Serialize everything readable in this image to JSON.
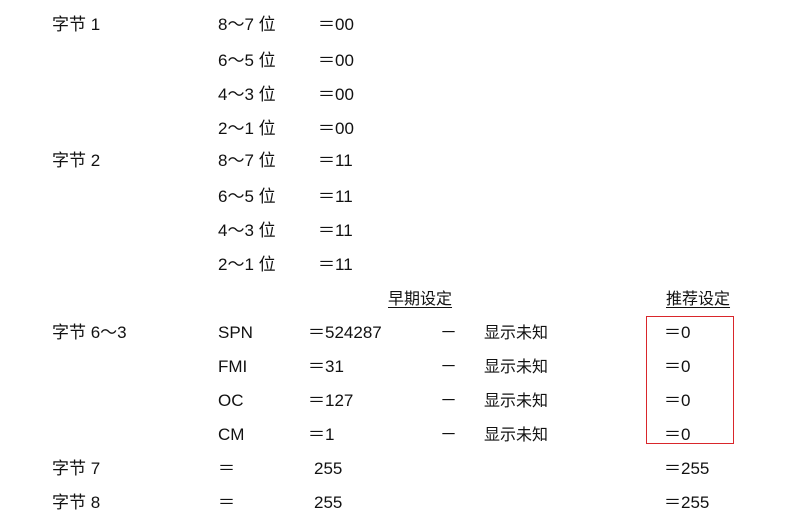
{
  "bytes_1_2": [
    {
      "label": "字节 1",
      "bits": [
        {
          "range": "8～7 位",
          "value": "＝00"
        },
        {
          "range": "6～5 位",
          "value": "＝00"
        },
        {
          "range": "4～3 位",
          "value": "＝00"
        },
        {
          "range": "2～1 位",
          "value": "＝00"
        }
      ]
    },
    {
      "label": "字节 2",
      "bits": [
        {
          "range": "8～7 位",
          "value": "＝11"
        },
        {
          "range": "6～5 位",
          "value": "＝11"
        },
        {
          "range": "4～3 位",
          "value": "＝11"
        },
        {
          "range": "2～1 位",
          "value": "＝11"
        }
      ]
    }
  ],
  "headers": {
    "early": "早期设定",
    "recommended": "推荐设定"
  },
  "byte_6_3": {
    "label": "字节 6～3",
    "rows": [
      {
        "field": "SPN",
        "early": "＝524287",
        "dash": "－",
        "note": "显示未知",
        "recommended": "＝0"
      },
      {
        "field": "FMI",
        "early": "＝31",
        "dash": "－",
        "note": "显示未知",
        "recommended": "＝0"
      },
      {
        "field": "OC",
        "early": "＝127",
        "dash": "－",
        "note": "显示未知",
        "recommended": "＝0"
      },
      {
        "field": "CM",
        "early": "＝1",
        "dash": "－",
        "note": "显示未知",
        "recommended": "＝0"
      }
    ]
  },
  "byte_7": {
    "label": "字节 7",
    "eq": "＝",
    "value": "255",
    "recommended": "＝255"
  },
  "byte_8": {
    "label": "字节 8",
    "eq": "＝",
    "value": "255",
    "recommended": "＝255"
  },
  "highlight_color": "#d9262b"
}
